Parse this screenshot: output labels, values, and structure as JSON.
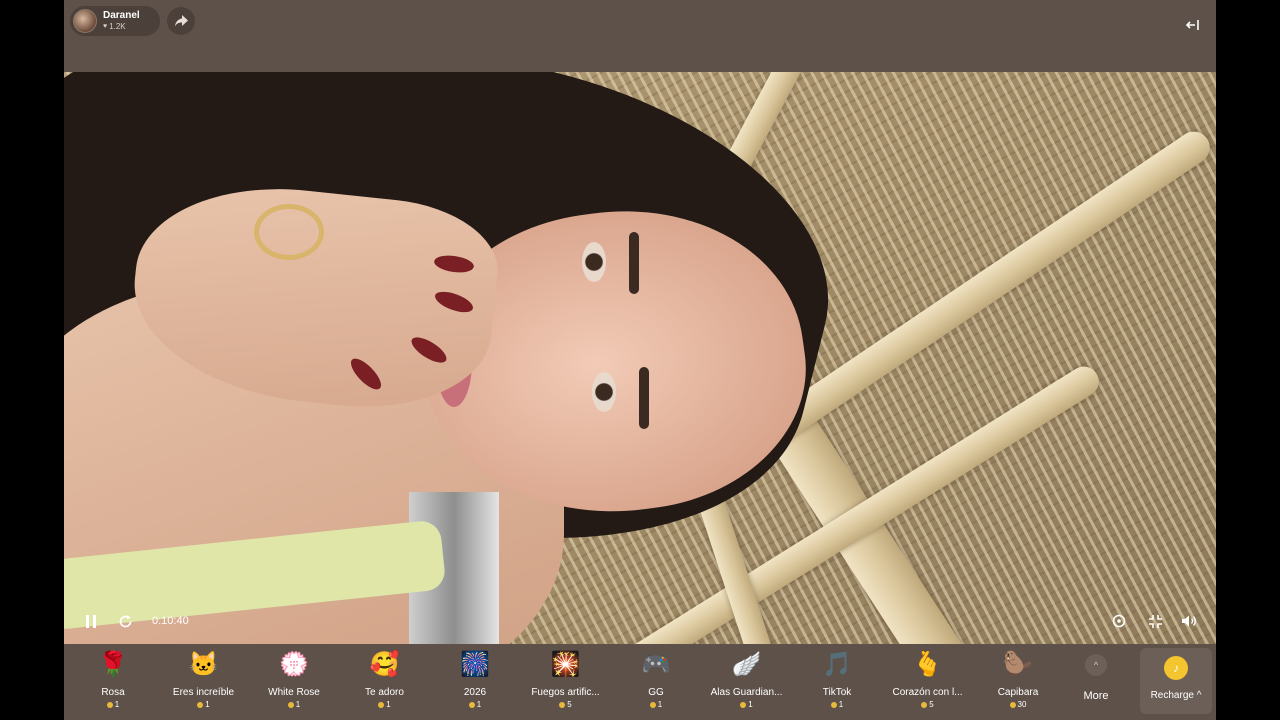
{
  "host": {
    "name": "Daranel",
    "likes": "1.2K"
  },
  "player": {
    "elapsed": "0:10:40"
  },
  "gifts": [
    {
      "name": "Rosa",
      "price": "1",
      "icon": "🌹"
    },
    {
      "name": "Eres increíble",
      "price": "1",
      "icon": "🐱"
    },
    {
      "name": "White Rose",
      "price": "1",
      "icon": "💮"
    },
    {
      "name": "Te adoro",
      "price": "1",
      "icon": "🥰"
    },
    {
      "name": "2026",
      "price": "1",
      "icon": "🎆"
    },
    {
      "name": "Fuegos artific...",
      "price": "5",
      "icon": "🎇"
    },
    {
      "name": "GG",
      "price": "1",
      "icon": "🎮"
    },
    {
      "name": "Alas Guardian...",
      "price": "1",
      "icon": "🪽"
    },
    {
      "name": "TikTok",
      "price": "1",
      "icon": "🎵"
    },
    {
      "name": "Corazón con l...",
      "price": "5",
      "icon": "🫰"
    },
    {
      "name": "Capibara",
      "price": "30",
      "icon": "🦫"
    }
  ],
  "more": {
    "label": "More",
    "icon": "^"
  },
  "recharge": {
    "label": "Recharge ^",
    "icon": "♪"
  }
}
